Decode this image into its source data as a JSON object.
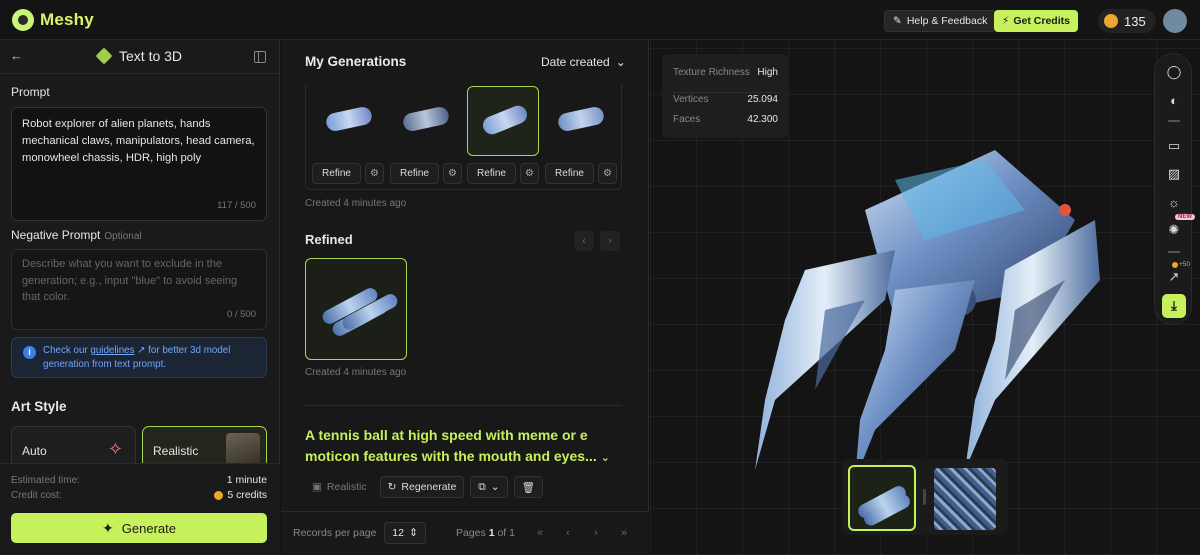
{
  "app": {
    "brand": "Meshy"
  },
  "header": {
    "help_label": "Help & Feedback",
    "credits_label": "Get Credits",
    "credit_balance": "135"
  },
  "left_panel": {
    "title": "Text to 3D",
    "prompt_label": "Prompt",
    "prompt_value": "Robot explorer of alien planets, hands mechanical claws, manipulators, head camera, monowheel chassis, HDR, high poly",
    "prompt_counter": "117 / 500",
    "negative_label": "Negative Prompt",
    "negative_optional": "Optional",
    "negative_placeholder": "Describe what you want to exclude in the generation; e.g., input \"blue\" to avoid seeing that color.",
    "negative_counter": "0 / 500",
    "info_prefix": "Check our",
    "info_link": "guidelines",
    "info_suffix": "for better 3d model generation from text prompt.",
    "art_style_label": "Art Style",
    "styles": [
      {
        "label": "Auto"
      },
      {
        "label": "Realistic"
      }
    ],
    "estimated_label": "Estimated time:",
    "estimated_value": "1 minute",
    "cost_label": "Credit cost:",
    "cost_value": "5 credits",
    "generate_label": "Generate"
  },
  "middle_panel": {
    "title": "My Generations",
    "sort_label": "Date created",
    "refine_label": "Refine",
    "created_1": "Created 4 minutes ago",
    "refined_title": "Refined",
    "created_2": "Created 4 minutes ago",
    "next_prompt": "A tennis ball at high speed with meme or e moticon features with the mouth and eyes...",
    "style_tag": "Realistic",
    "regenerate_label": "Regenerate",
    "records_label": "Records per page",
    "records_value": "12",
    "pages_label": "Pages",
    "page_current": "1",
    "page_of": "of",
    "page_total": "1"
  },
  "viewer": {
    "texture_label": "Texture Richness",
    "texture_value": "High",
    "vertices_label": "Vertices",
    "vertices_value": "25.094",
    "faces_label": "Faces",
    "faces_value": "42.300",
    "new_badge": "NEW",
    "plus_badge": "+50"
  },
  "colors": {
    "accent": "#c6f15b",
    "background": "#121212",
    "panel": "#1a1a1a",
    "link": "#6fa8ff"
  }
}
